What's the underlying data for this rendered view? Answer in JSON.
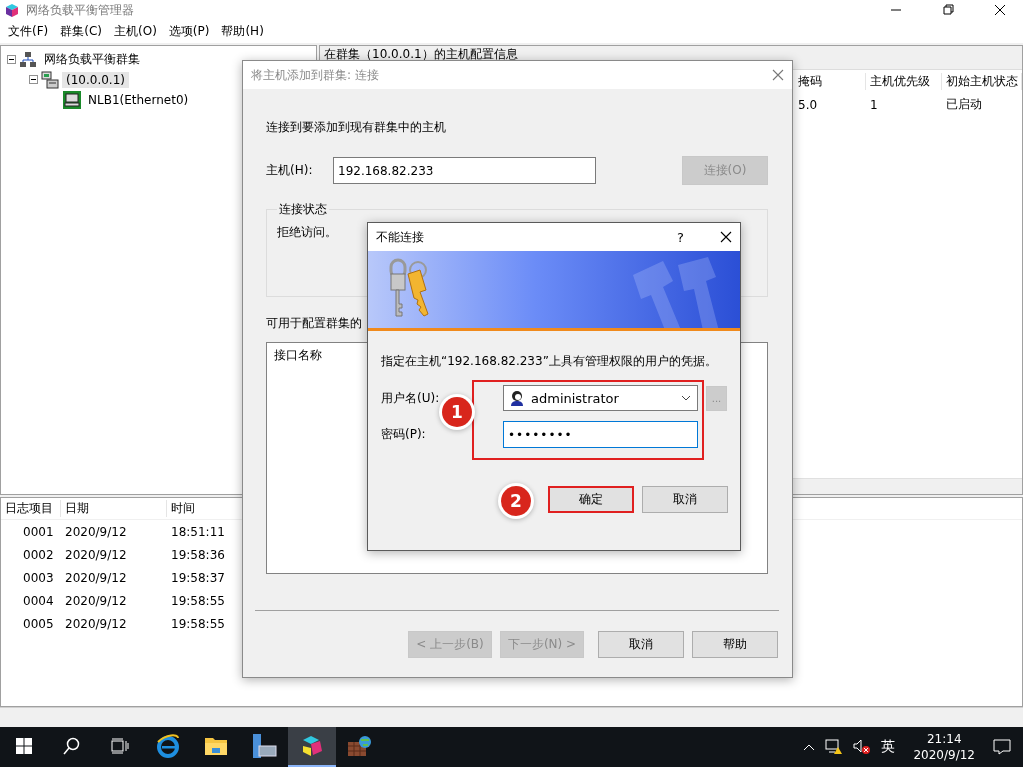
{
  "window": {
    "title": "网络负载平衡管理器"
  },
  "menu": [
    "文件(F)",
    "群集(C)",
    "主机(O)",
    "选项(P)",
    "帮助(H)"
  ],
  "tree": [
    {
      "label": "网络负载平衡群集",
      "kind": "clusters",
      "expanded": true,
      "selected": false,
      "children": [
        {
          "label": "(10.0.0.1)",
          "kind": "cluster",
          "expanded": true,
          "selected": true,
          "children": [
            {
              "label": "NLB1(Ethernet0)",
              "kind": "host",
              "selected": false
            }
          ]
        }
      ]
    }
  ],
  "host_panel": {
    "title": "在群集（10.0.0.1）的主机配置信息",
    "columns": [
      "掩码",
      "主机优先级",
      "初始主机状态"
    ],
    "rows": [
      [
        "5.0",
        "1",
        "已启动"
      ]
    ]
  },
  "log": {
    "columns": [
      "日志项目",
      "日期",
      "时间"
    ],
    "rows": [
      [
        "0001",
        "2020/9/12",
        "18:51:11"
      ],
      [
        "0002",
        "2020/9/12",
        "19:58:36"
      ],
      [
        "0003",
        "2020/9/12",
        "19:58:37"
      ],
      [
        "0004",
        "2020/9/12",
        "19:58:55"
      ],
      [
        "0005",
        "2020/9/12",
        "19:58:55"
      ]
    ]
  },
  "connect_dialog": {
    "title": "将主机添加到群集: 连接",
    "active": false,
    "intro": "连接到要添加到现有群集中的主机",
    "host_label": "主机(H):",
    "host_value": "192.168.82.233",
    "connect_button": {
      "label": "连接(O)",
      "disabled": true
    },
    "status_group": "连接状态",
    "status_text": "拒绝访问。",
    "interfaces_label": "可用于配置群集的",
    "interfaces_column": "接口名称",
    "buttons": [
      {
        "label": "< 上一步(B)",
        "disabled": true
      },
      {
        "label": "下一步(N) >",
        "disabled": true
      },
      {
        "label": "取消",
        "disabled": false
      },
      {
        "label": "帮助",
        "disabled": false
      }
    ]
  },
  "credentials_dialog": {
    "title": "不能连接",
    "help": "?",
    "prompt": "指定在主机“192.168.82.233”上具有管理权限的用户的凭据。",
    "username_label": "用户名(U):",
    "username": "administrator",
    "browse": "...",
    "password_label": "密码(P):",
    "password": "••••••••",
    "buttons": [
      {
        "label": "确定",
        "highlighted": true
      },
      {
        "label": "取消",
        "highlighted": false
      }
    ]
  },
  "annotations": [
    {
      "number": "1"
    },
    {
      "number": "2"
    }
  ],
  "taskbar": {
    "apps": [
      {
        "kind": "browser",
        "active": false
      },
      {
        "kind": "folder",
        "active": false
      },
      {
        "kind": "server",
        "active": false
      },
      {
        "kind": "nlb",
        "active": true
      },
      {
        "kind": "box",
        "active": false
      }
    ],
    "ime": "英",
    "time": "21:14",
    "date": "2020/9/12"
  }
}
